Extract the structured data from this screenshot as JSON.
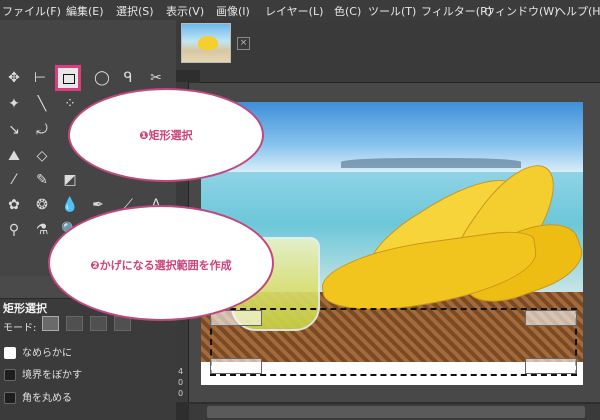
{
  "menubar": {
    "items": [
      "ファイル(F)",
      "編集(E)",
      "選択(S)",
      "表示(V)",
      "画像(I)",
      "レイヤー(L)",
      "色(C)",
      "ツール(T)",
      "フィルター(R)",
      "ウィンドウ(W)",
      "ヘルプ(H)"
    ]
  },
  "toolbox": {
    "tools": [
      "move",
      "align",
      "rect-select",
      "ellipse-select",
      "free-select",
      "scissors",
      "fuzzy-select",
      "color-select",
      "paths",
      "text",
      "zoom",
      "measure",
      "warp",
      "crop",
      "flip",
      "paint-bucket",
      "gradient",
      "pencil",
      "brush",
      "eraser",
      "airbrush",
      "ink",
      "clone",
      "heal",
      "smudge",
      "blur",
      "dodge"
    ]
  },
  "options": {
    "title": "矩形選択",
    "mode_label": "モード:",
    "antialias_label": "なめらかに",
    "feather_label": "境界をぼかす",
    "round_label": "角を丸める"
  },
  "canvas": {
    "ruler_v_labels": [
      "4",
      "0",
      "0"
    ]
  },
  "annotations": {
    "callout1": "❶矩形選択",
    "callout2": "❷かげになる選択範囲を作成"
  },
  "colors": {
    "highlight": "#d9407f",
    "callout_text": "#d0437a"
  }
}
